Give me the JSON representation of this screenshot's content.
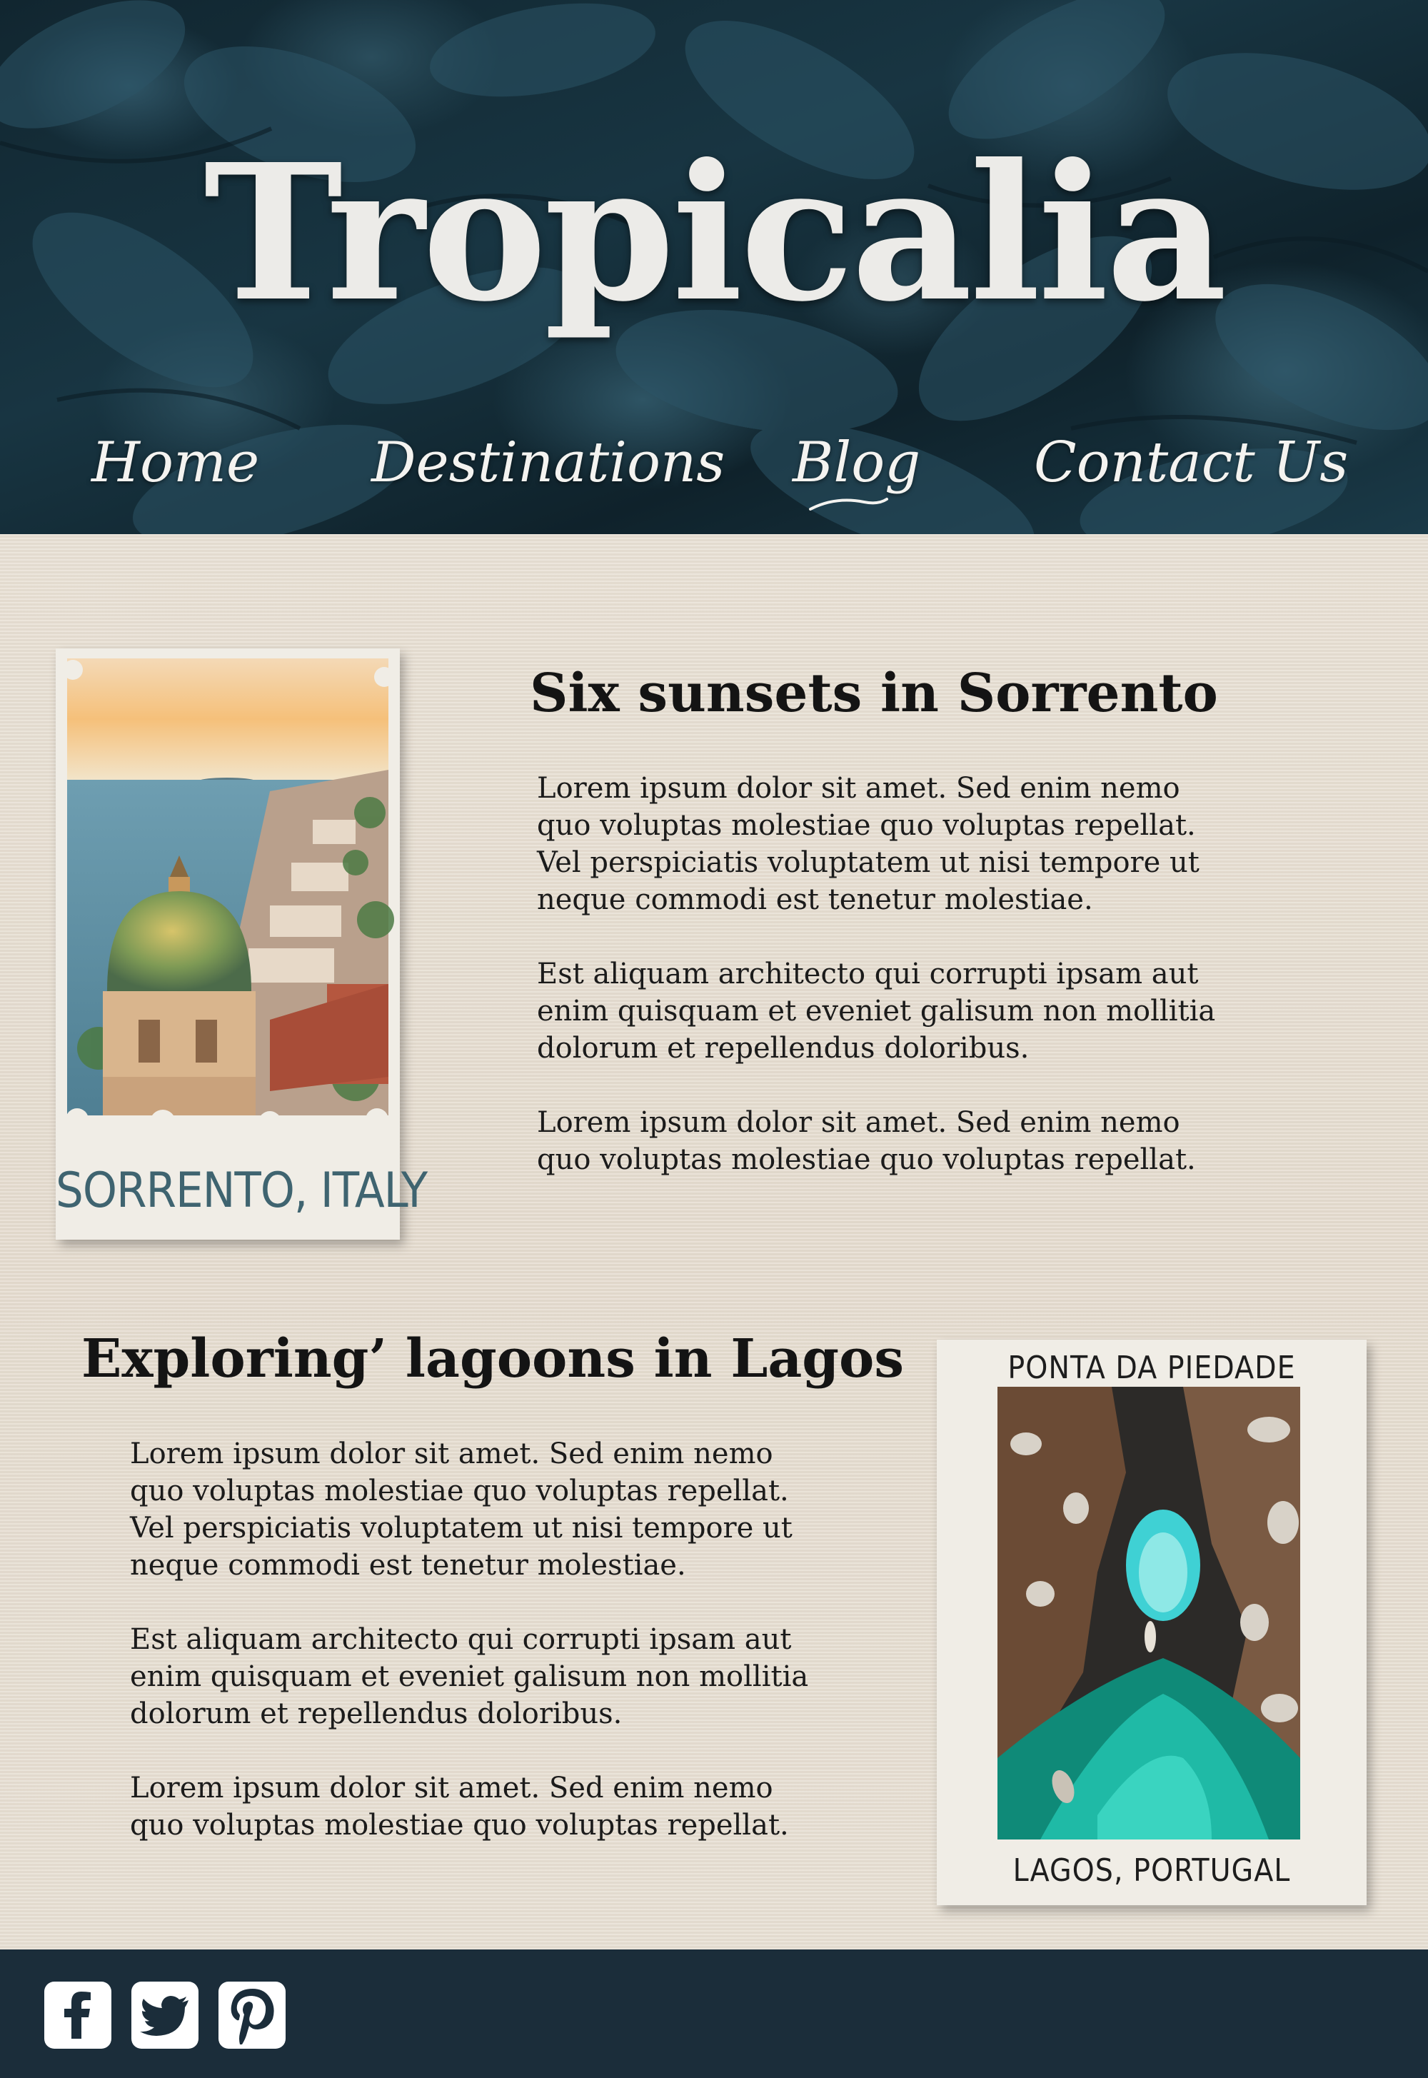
{
  "header": {
    "site_title": "Tropicalia",
    "nav": [
      {
        "label": "Home"
      },
      {
        "label": "Destinations"
      },
      {
        "label": "Blog"
      },
      {
        "label": "Contact Us"
      }
    ]
  },
  "posts": [
    {
      "title": "Six sunsets in Sorrento",
      "image_caption": "SORRENTO, ITALY",
      "paragraphs": [
        "Lorem ipsum dolor sit amet. Sed enim nemo quo voluptas molestiae quo voluptas repellat. Vel perspiciatis voluptatem ut nisi tempore ut neque commodi est tenetur molestiae.",
        "Est aliquam architecto qui corrupti ipsam aut enim quisquam et eveniet galisum non mollitia dolorum et repellendus doloribus.",
        "Lorem ipsum dolor sit amet. Sed enim nemo quo voluptas molestiae quo voluptas repellat."
      ]
    },
    {
      "title": "Exploring’ lagoons in Lagos",
      "image_top_caption": "PONTA DA PIEDADE",
      "image_caption": "LAGOS, PORTUGAL",
      "paragraphs": [
        "Lorem ipsum dolor sit amet. Sed enim nemo quo voluptas molestiae quo voluptas repellat. Vel perspiciatis voluptatem ut nisi tempore ut neque commodi est tenetur molestiae.",
        "Est aliquam architecto qui corrupti ipsam aut enim quisquam et eveniet galisum non mollitia dolorum et repellendus doloribus.",
        "Lorem ipsum dolor sit amet. Sed enim nemo quo voluptas molestiae quo voluptas repellat."
      ]
    }
  ],
  "footer": {
    "social": [
      {
        "icon": "facebook-icon"
      },
      {
        "icon": "twitter-icon"
      },
      {
        "icon": "pinterest-icon"
      }
    ]
  },
  "colors": {
    "header_leaf": "#1f3f4d",
    "page_bg": "#e6ddd0",
    "footer_bg": "#1b2d3a",
    "caption_teal": "#3f6470"
  }
}
